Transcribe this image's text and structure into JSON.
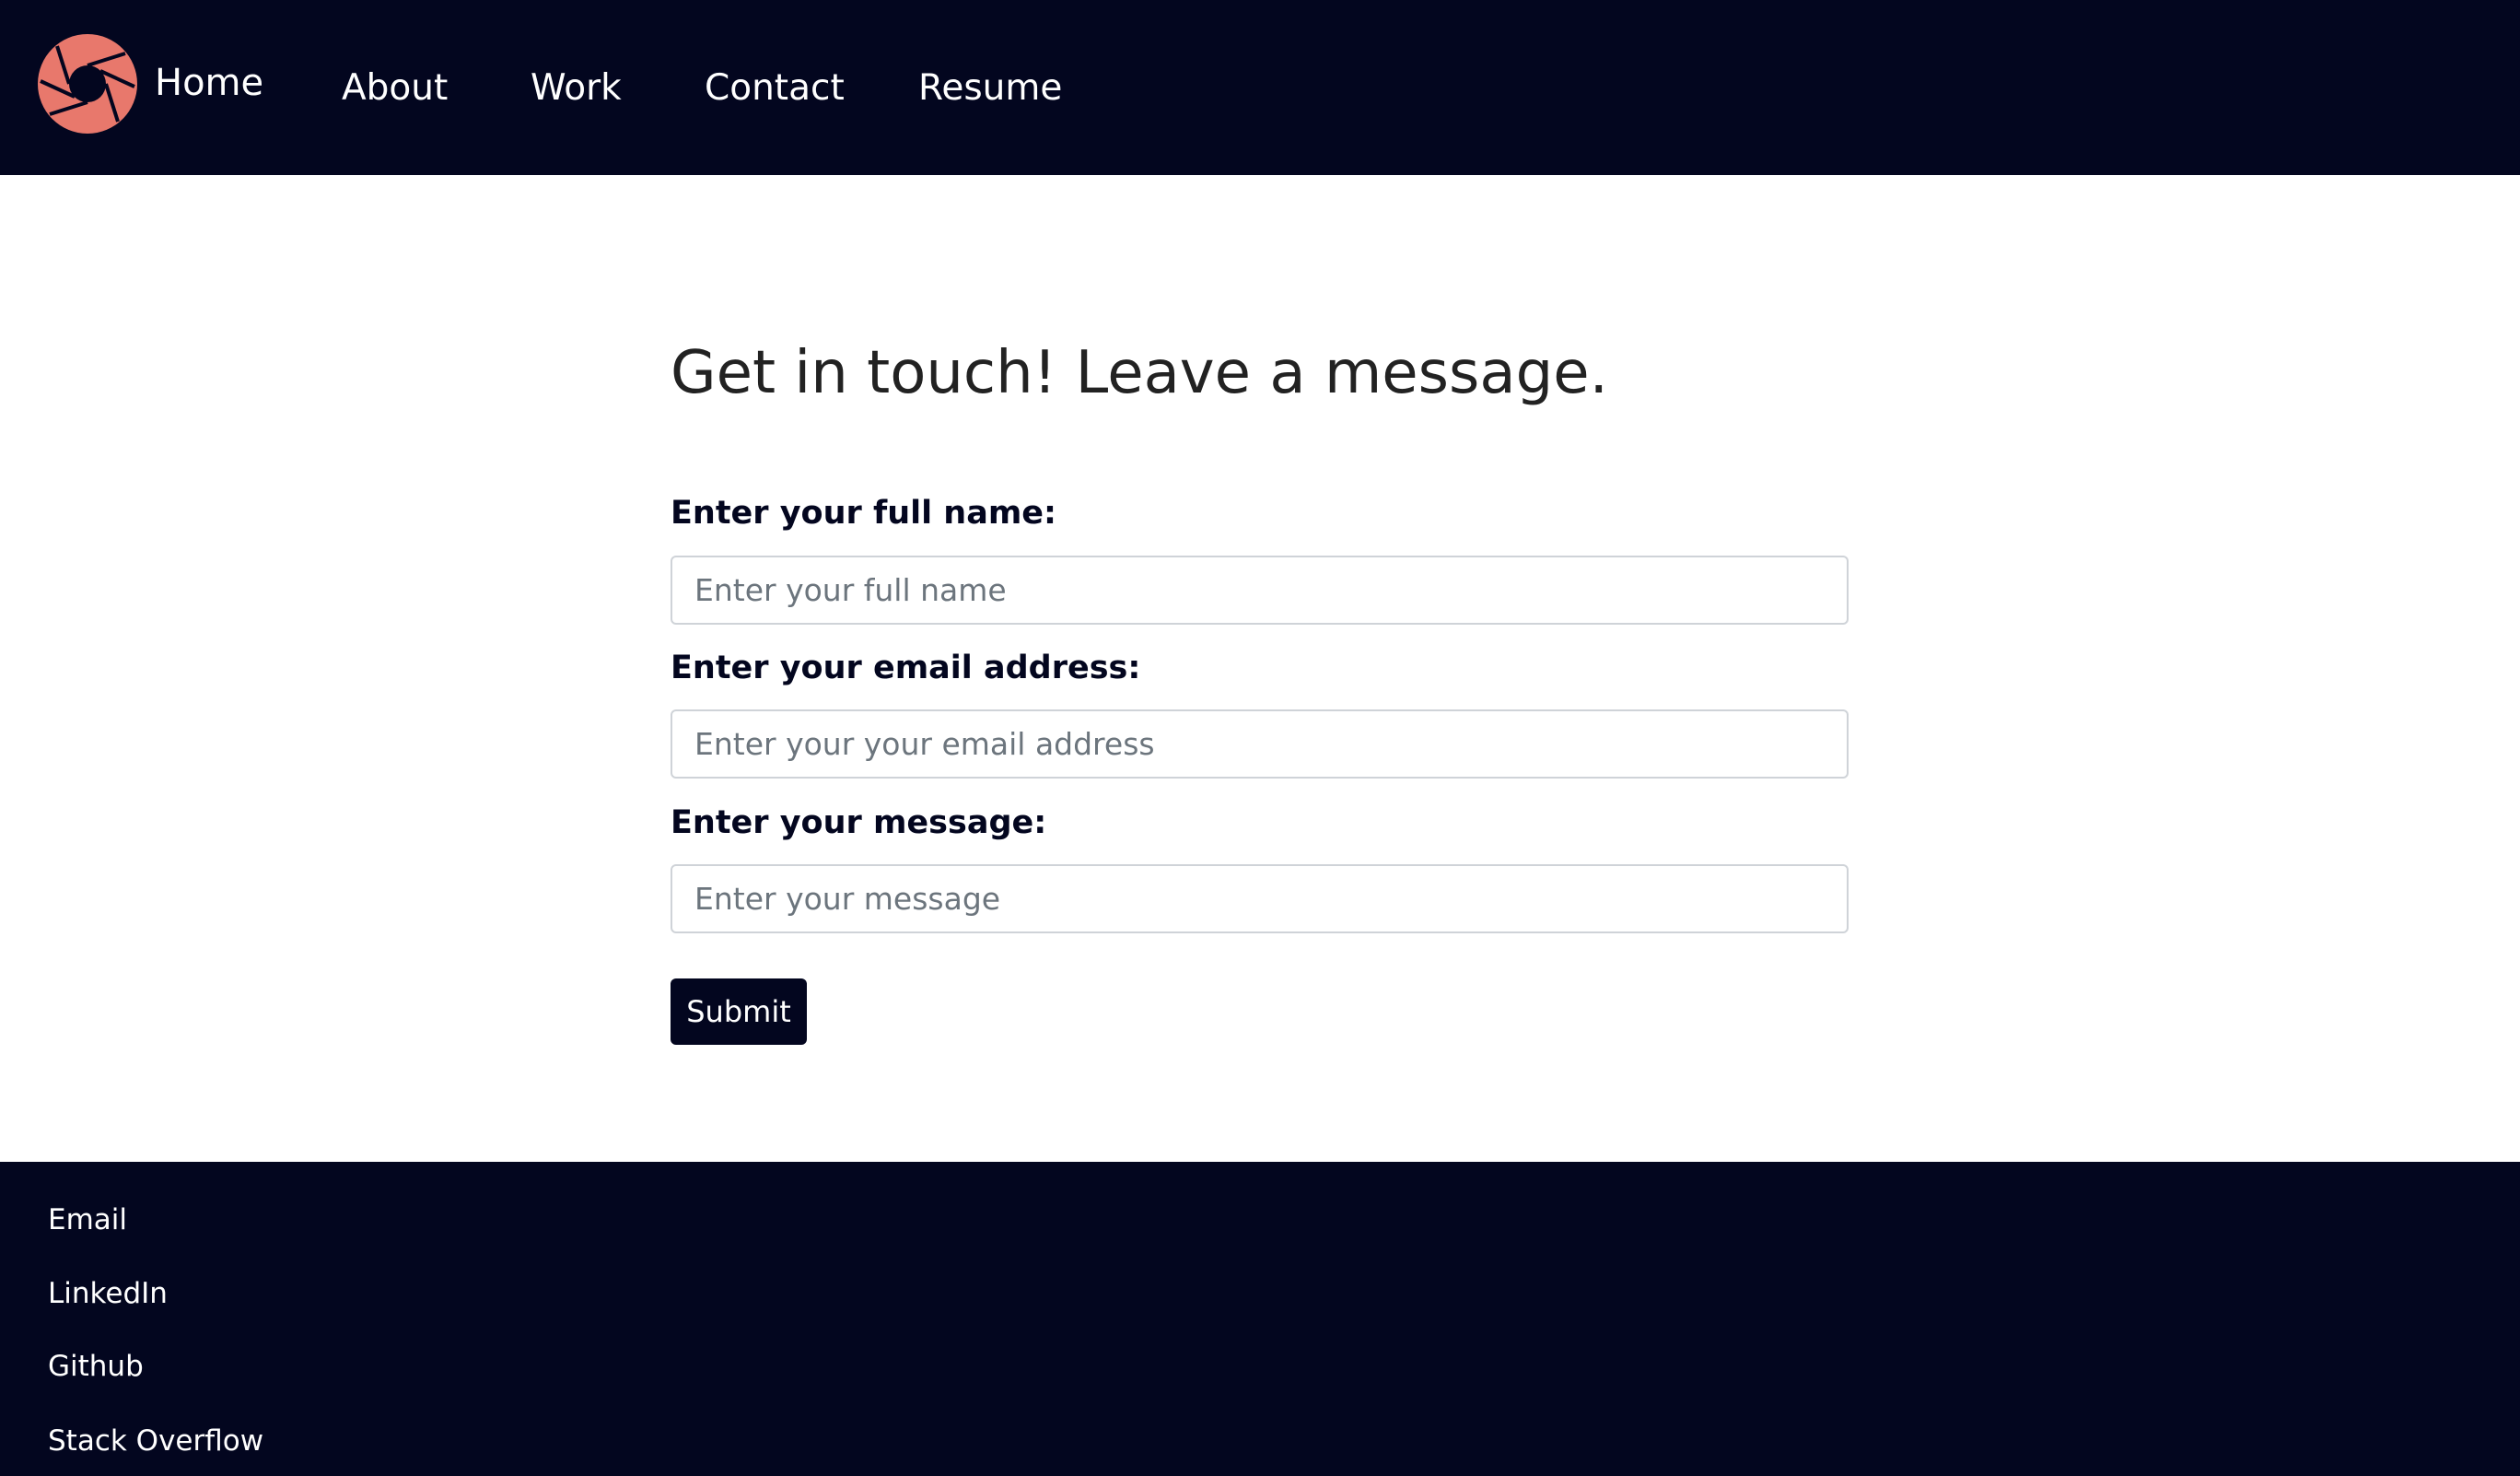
{
  "nav": {
    "logo_icon": "camera-aperture-icon",
    "logo_color": "#e8786c",
    "background": "#03061f",
    "items": [
      {
        "label": "Home"
      },
      {
        "label": "About"
      },
      {
        "label": "Work"
      },
      {
        "label": "Contact"
      },
      {
        "label": "Resume"
      }
    ]
  },
  "main": {
    "heading": "Get in touch! Leave a message.",
    "form": {
      "name_label": "Enter your full name:",
      "name_placeholder": "Enter your full name",
      "name_value": "",
      "email_label": "Enter your email address:",
      "email_placeholder": "Enter your your email address",
      "email_value": "",
      "message_label": "Enter your message:",
      "message_placeholder": "Enter your message",
      "message_value": "",
      "submit_label": "Submit"
    }
  },
  "footer": {
    "links": [
      {
        "label": "Email"
      },
      {
        "label": "LinkedIn"
      },
      {
        "label": "Github"
      },
      {
        "label": "Stack Overflow"
      }
    ]
  }
}
